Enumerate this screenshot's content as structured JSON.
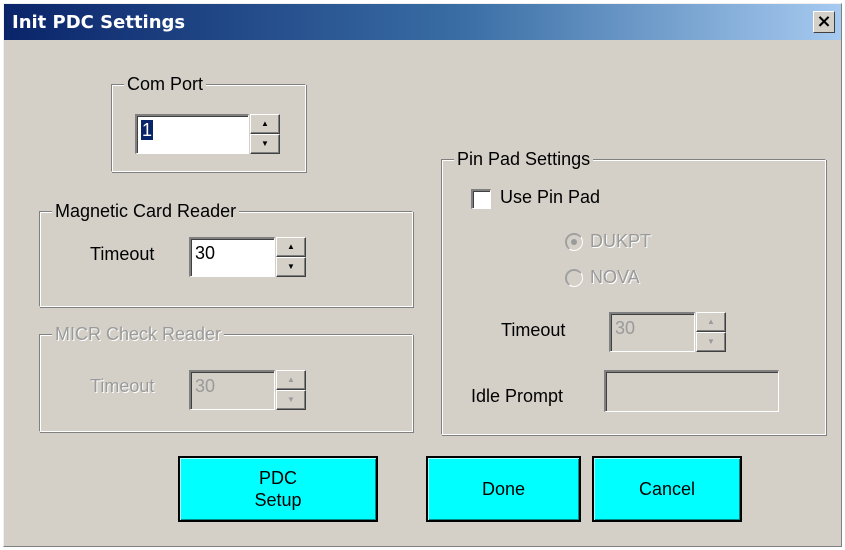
{
  "window": {
    "title": "Init PDC Settings",
    "close_glyph": "×"
  },
  "com_port": {
    "legend": "Com Port",
    "value": "1"
  },
  "magnetic_card_reader": {
    "legend": "Magnetic Card Reader",
    "timeout_label": "Timeout",
    "timeout_value": "30"
  },
  "micr_check_reader": {
    "legend": "MICR Check Reader",
    "timeout_label": "Timeout",
    "timeout_value": "30"
  },
  "pin_pad": {
    "legend": "Pin Pad Settings",
    "use_pin_pad_label": "Use Pin Pad",
    "use_pin_pad_checked": false,
    "key_options": [
      {
        "label": "DUKPT",
        "selected": true
      },
      {
        "label": "NOVA",
        "selected": false
      }
    ],
    "timeout_label": "Timeout",
    "timeout_value": "30",
    "idle_prompt_label": "Idle Prompt",
    "idle_prompt_value": ""
  },
  "buttons": {
    "pdc_setup": "PDC\nSetup",
    "done": "Done",
    "cancel": "Cancel"
  },
  "colors": {
    "title_gradient_start": "#0a246a",
    "title_gradient_end": "#a6caf0",
    "dialog_face": "#d4d0c8",
    "action_button": "#00ffff",
    "disabled_text": "#9a9a9a"
  },
  "icons": {
    "spin_up": "▲",
    "spin_down": "▼"
  }
}
